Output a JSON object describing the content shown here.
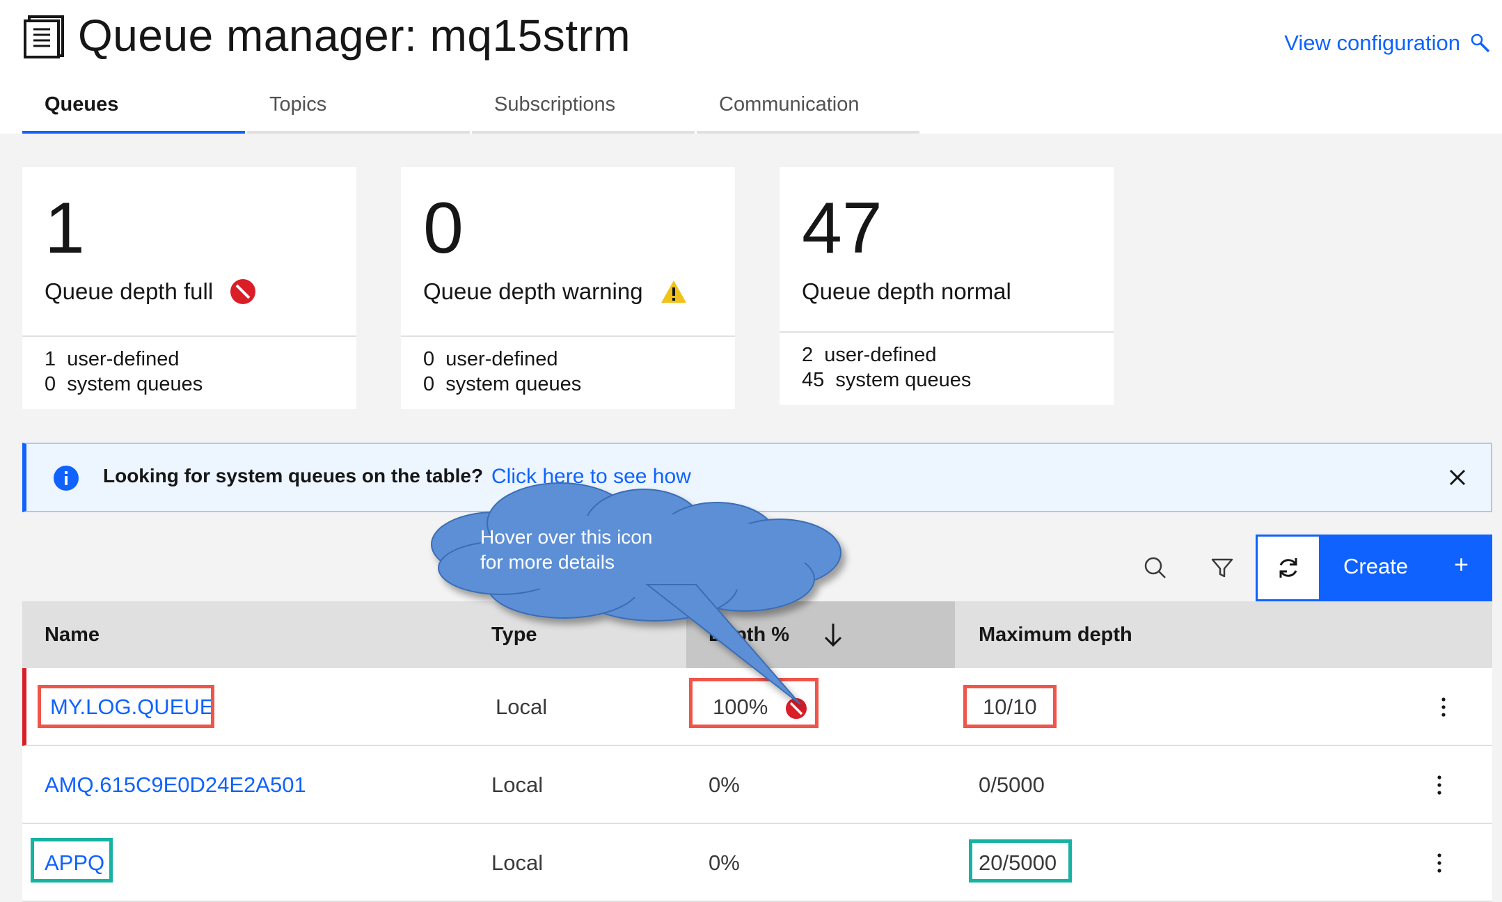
{
  "header": {
    "title": "Queue manager: mq15strm",
    "view_config_label": "View configuration"
  },
  "tabs": [
    {
      "label": "Queues",
      "active": true
    },
    {
      "label": "Topics",
      "active": false
    },
    {
      "label": "Subscriptions",
      "active": false
    },
    {
      "label": "Communication",
      "active": false
    }
  ],
  "tiles": [
    {
      "count": "1",
      "label": "Queue depth full",
      "status": "error",
      "user_defined_count": "1",
      "user_defined_label": "user-defined",
      "system_count": "0",
      "system_label": "system queues"
    },
    {
      "count": "0",
      "label": "Queue depth warning",
      "status": "warning",
      "user_defined_count": "0",
      "user_defined_label": "user-defined",
      "system_count": "0",
      "system_label": "system queues"
    },
    {
      "count": "47",
      "label": "Queue depth normal",
      "status": "normal",
      "user_defined_count": "2",
      "user_defined_label": "user-defined",
      "system_count": "45",
      "system_label": "system queues"
    }
  ],
  "banner": {
    "message": "Looking for system queues on the table?",
    "link": "Click here to see how"
  },
  "toolbar": {
    "create_label": "Create",
    "create_plus": "+"
  },
  "table": {
    "columns": [
      "Name",
      "Type",
      "Depth %",
      "Maximum depth"
    ],
    "rows": [
      {
        "name": "MY.LOG.QUEUE",
        "type": "Local",
        "depth": "100%",
        "max_depth": "10/10",
        "status": "error"
      },
      {
        "name": "AMQ.615C9E0D24E2A501",
        "type": "Local",
        "depth": "0%",
        "max_depth": "0/5000",
        "status": "normal"
      },
      {
        "name": "APPQ",
        "type": "Local",
        "depth": "0%",
        "max_depth": "20/5000",
        "status": "normal"
      }
    ]
  },
  "callout": {
    "line1": "Hover over this icon",
    "line2": "for more details"
  },
  "colors": {
    "accent": "#0f62fe",
    "error": "#da1e28",
    "warning": "#f1c21b",
    "annotation_red": "#f0554a",
    "annotation_teal": "#16b3a2",
    "callout_fill": "#5b8fd6"
  }
}
